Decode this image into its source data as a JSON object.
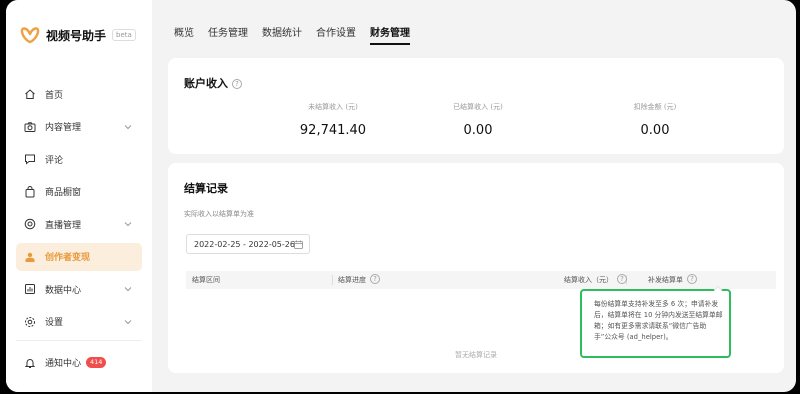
{
  "app": {
    "title": "视频号助手",
    "beta": "beta"
  },
  "sidebar": {
    "items": [
      {
        "label": "首页",
        "icon": "home-icon",
        "chevron": false,
        "active": false
      },
      {
        "label": "内容管理",
        "icon": "camera-icon",
        "chevron": true,
        "active": false
      },
      {
        "label": "评论",
        "icon": "comment-icon",
        "chevron": false,
        "active": false
      },
      {
        "label": "商品橱窗",
        "icon": "bag-icon",
        "chevron": false,
        "active": false
      },
      {
        "label": "直播管理",
        "icon": "live-icon",
        "chevron": true,
        "active": false
      },
      {
        "label": "创作者变现",
        "icon": "creator-icon",
        "chevron": false,
        "active": true
      },
      {
        "label": "数据中心",
        "icon": "chart-icon",
        "chevron": true,
        "active": false
      },
      {
        "label": "设置",
        "icon": "gear-icon",
        "chevron": true,
        "active": false
      }
    ],
    "notify": {
      "label": "通知中心",
      "badge": "414"
    }
  },
  "tabs": [
    "概览",
    "任务管理",
    "数据统计",
    "合作设置",
    "财务管理"
  ],
  "active_tab": "财务管理",
  "income": {
    "title": "账户收入",
    "stats": [
      {
        "label": "未结算收入 (元)",
        "value": "92,741.40"
      },
      {
        "label": "已结算收入 (元)",
        "value": "0.00"
      },
      {
        "label": "扣除金额 (元)",
        "value": "0.00"
      }
    ]
  },
  "settlement": {
    "title": "结算记录",
    "subtitle": "实际收入以结算单为准",
    "date_range": "2022-02-25 - 2022-05-26",
    "columns": [
      "结算区间",
      "结算进度",
      "结算收入（元）",
      "补发结算单"
    ],
    "empty_text": "暂无结算记录",
    "tooltip": "每份结算单支持补发至多 6 次；申请补发后，结算单将在 10 分钟内发送至结算单邮箱；如有更多需求请联系“微信广告助手”公众号 (ad_helper)。"
  },
  "colors": {
    "accent": "#e89a3c",
    "active_bg": "#fbeedd",
    "highlight": "#2ebc5c",
    "badge": "#f04d4d"
  }
}
